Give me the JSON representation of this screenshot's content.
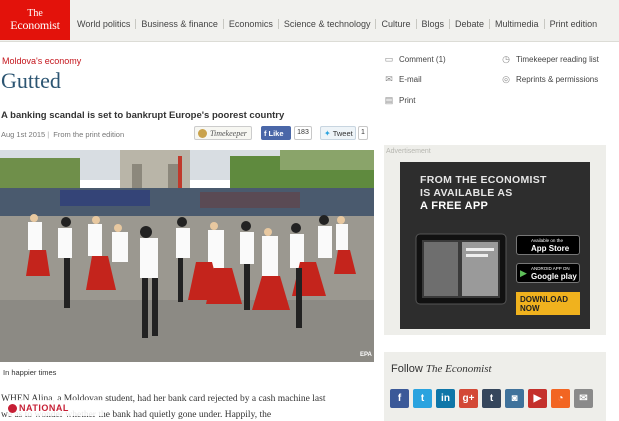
{
  "brand": {
    "logo_line1": "The",
    "logo_line2": "Economist",
    "color": "#e3120b"
  },
  "nav": {
    "items": [
      "World politics",
      "Business & finance",
      "Economics",
      "Science & technology",
      "Culture",
      "Blogs",
      "Debate",
      "Multimedia",
      "Print edition"
    ]
  },
  "article": {
    "kicker": "Moldova's economy",
    "title": "Gutted",
    "rubric": "A banking scandal is set to bankrupt Europe's poorest country",
    "date": "Aug 1st 2015",
    "source": "From the print edition",
    "timekeeper_label": "Timekeeper",
    "fb_like_label": "Like",
    "fb_like_count": "183",
    "tweet_label": "Tweet",
    "tweet_count": "1",
    "photo_caption": "In happier times",
    "photo_credit": "EPA",
    "body_line1": "WHEN Alina, a Moldovan student, had her bank card rejected by a cash machine last",
    "body_line2": "we              as to wonder whether the bank had quietly gone under. Happily, the"
  },
  "watermark": {
    "text": "NATIONAL"
  },
  "tools": {
    "comment": "Comment (1)",
    "email": "E-mail",
    "print": "Print",
    "timekeeper_list": "Timekeeper reading list",
    "reprints": "Reprints & permissions"
  },
  "ad": {
    "label": "Advertisement",
    "line1": "FROM THE ECONOMIST",
    "line2": "IS AVAILABLE AS",
    "line3": "A FREE APP",
    "appstore_small": "Available on the",
    "appstore_big": "App Store",
    "googleplay_small": "ANDROID APP ON",
    "googleplay_big": "Google play",
    "download": "DOWNLOAD NOW"
  },
  "follow": {
    "prefix": "Follow",
    "brand": "The Economist",
    "networks": [
      {
        "icon": "facebook-icon",
        "glyph": "f",
        "color": "#3b5998"
      },
      {
        "icon": "twitter-icon",
        "glyph": "t",
        "color": "#2aa3df"
      },
      {
        "icon": "linkedin-icon",
        "glyph": "in",
        "color": "#0e76a8"
      },
      {
        "icon": "googleplus-icon",
        "glyph": "g+",
        "color": "#d34836"
      },
      {
        "icon": "tumblr-icon",
        "glyph": "t",
        "color": "#35465c"
      },
      {
        "icon": "instagram-icon",
        "glyph": "◙",
        "color": "#3f729b"
      },
      {
        "icon": "youtube-icon",
        "glyph": "▶",
        "color": "#c4302b"
      },
      {
        "icon": "rss-icon",
        "glyph": "◔",
        "color": "#f26522"
      },
      {
        "icon": "mail-icon",
        "glyph": "✉",
        "color": "#8a8a8a"
      }
    ]
  }
}
